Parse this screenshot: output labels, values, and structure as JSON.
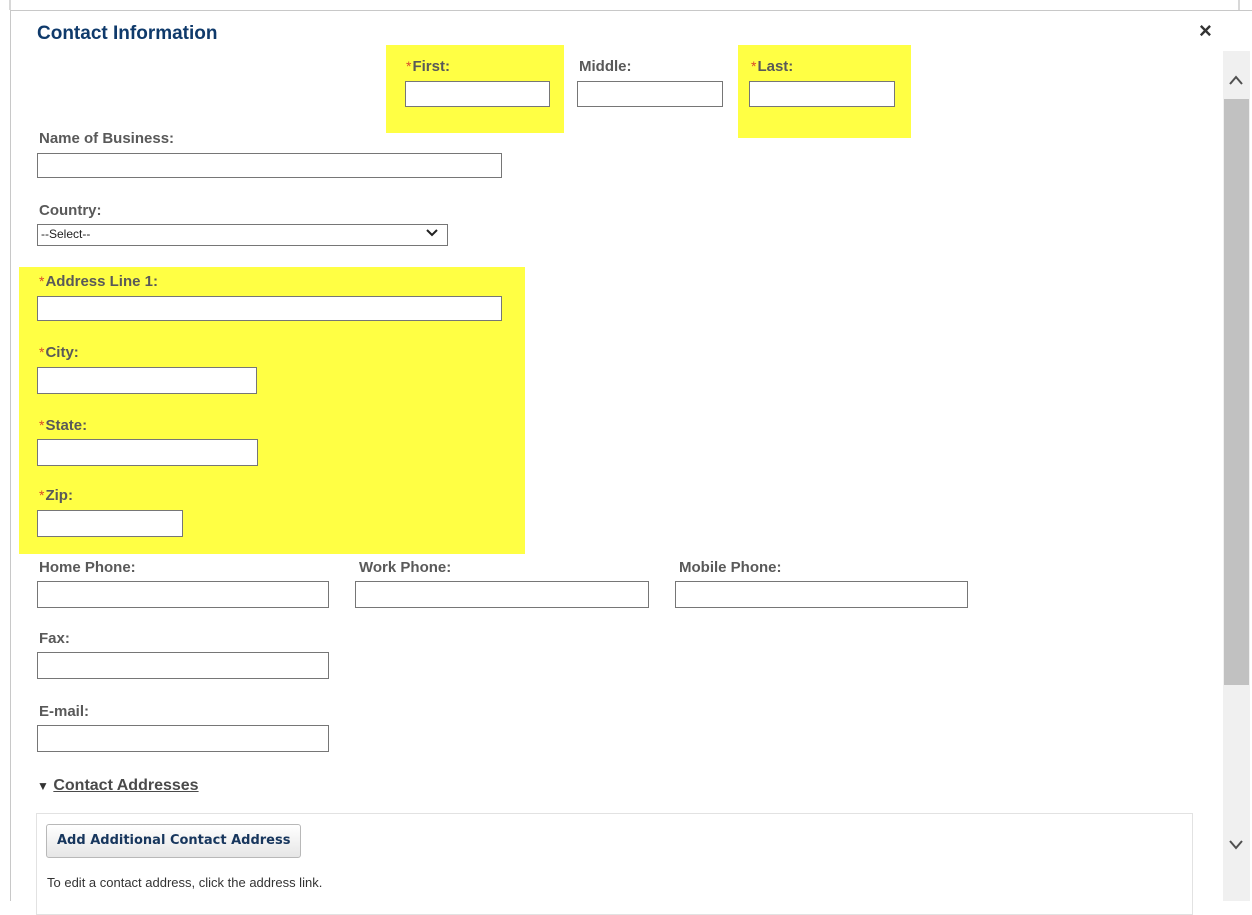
{
  "dialog": {
    "title": "Contact Information",
    "close_glyph": "×"
  },
  "required_marker": "*",
  "name": {
    "first_label": "First:",
    "middle_label": "Middle:",
    "last_label": "Last:",
    "first_value": "",
    "middle_value": "",
    "last_value": ""
  },
  "business": {
    "label": "Name of Business:",
    "value": ""
  },
  "country": {
    "label": "Country:",
    "selected": "--Select--"
  },
  "address": {
    "line1_label": "Address Line 1:",
    "city_label": "City:",
    "state_label": "State:",
    "zip_label": "Zip:"
  },
  "phones": {
    "home_label": "Home Phone:",
    "work_label": "Work Phone:",
    "mobile_label": "Mobile Phone:"
  },
  "fax": {
    "label": "Fax:"
  },
  "email": {
    "label": "E-mail:"
  },
  "contact_addresses": {
    "toggle_glyph": "▼",
    "link_label": "Contact Addresses",
    "add_button_label": "Add Additional Contact Address",
    "hint": "To edit a contact address, click the address link."
  },
  "scrollbar": {
    "up_glyph": "^",
    "down_glyph": "v"
  },
  "colors": {
    "highlight": "#ffff44",
    "title": "#0f3a6b",
    "required": "#d94b2b",
    "label": "#595959"
  }
}
